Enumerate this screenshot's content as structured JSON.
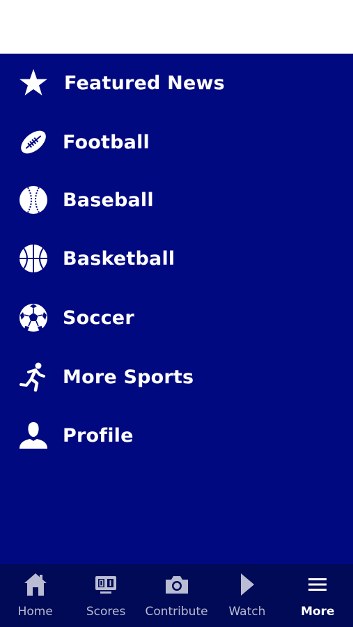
{
  "menu": {
    "items": [
      {
        "label": "Featured News",
        "icon": "star-icon"
      },
      {
        "label": "Football",
        "icon": "football-icon"
      },
      {
        "label": "Baseball",
        "icon": "baseball-icon"
      },
      {
        "label": "Basketball",
        "icon": "basketball-icon"
      },
      {
        "label": "Soccer",
        "icon": "soccer-ball-icon"
      },
      {
        "label": "More Sports",
        "icon": "runner-icon"
      },
      {
        "label": "Profile",
        "icon": "person-icon"
      }
    ]
  },
  "tab_bar": {
    "tabs": [
      {
        "label": "Home",
        "icon": "home-icon",
        "active": false
      },
      {
        "label": "Scores",
        "icon": "scoreboard-icon",
        "active": false
      },
      {
        "label": "Contribute",
        "icon": "camera-icon",
        "active": false
      },
      {
        "label": "Watch",
        "icon": "play-icon",
        "active": false
      },
      {
        "label": "More",
        "icon": "hamburger-icon",
        "active": true
      }
    ]
  },
  "colors": {
    "panel_background": "#00097f",
    "tab_bar_background": "#000a56",
    "text": "#ffffff",
    "inactive_tab": "#b9bcd2"
  }
}
